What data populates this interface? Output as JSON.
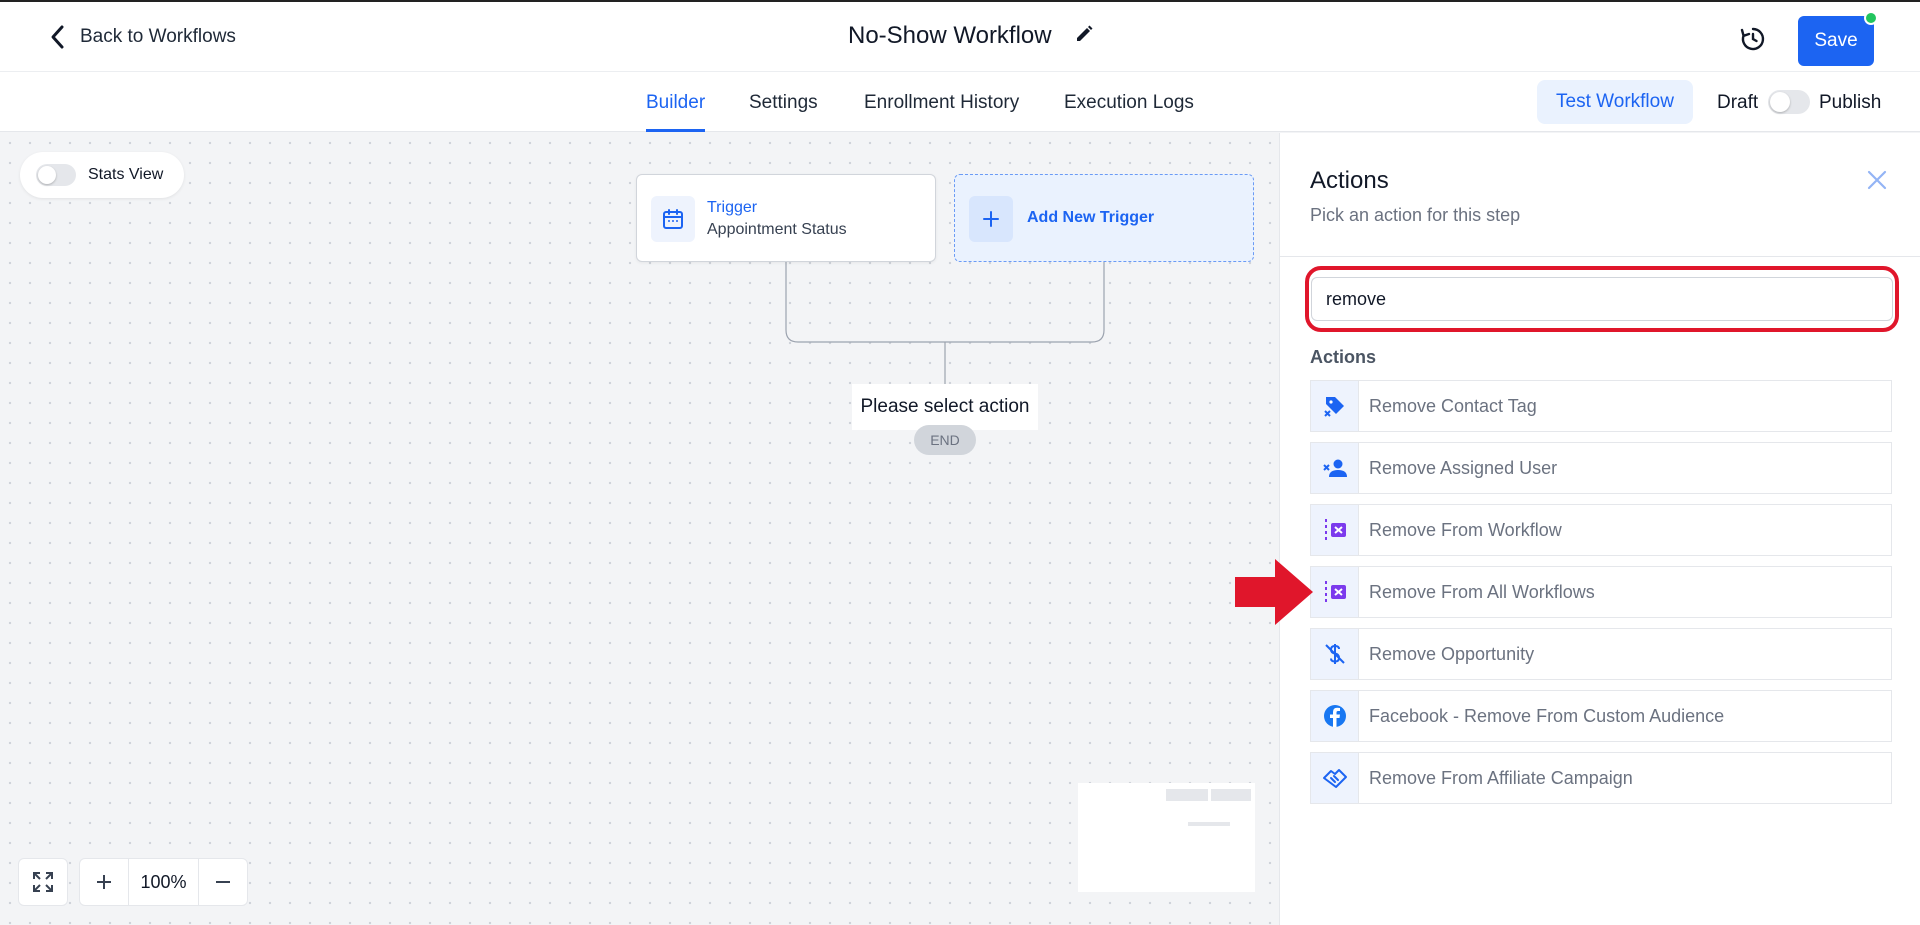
{
  "header": {
    "back_label": "Back to Workflows",
    "workflow_title": "No-Show Workflow",
    "save_label": "Save"
  },
  "tabs": [
    {
      "label": "Builder",
      "active": true
    },
    {
      "label": "Settings",
      "active": false
    },
    {
      "label": "Enrollment History",
      "active": false
    },
    {
      "label": "Execution Logs",
      "active": false
    }
  ],
  "toolbar": {
    "test_label": "Test Workflow",
    "draft_label": "Draft",
    "publish_label": "Publish",
    "published": false
  },
  "canvas": {
    "stats_label": "Stats View",
    "stats_on": false,
    "trigger_title": "Trigger",
    "trigger_sub": "Appointment Status",
    "add_trigger_label": "Add New Trigger",
    "select_action_label": "Please select action",
    "end_label": "END",
    "zoom_value": "100%"
  },
  "panel": {
    "title": "Actions",
    "subtitle": "Pick an action for this step",
    "search_value": "remove",
    "section_label": "Actions",
    "actions": [
      {
        "label": "Remove Contact Tag",
        "icon": "tag-remove-icon"
      },
      {
        "label": "Remove Assigned User",
        "icon": "user-remove-icon"
      },
      {
        "label": "Remove From Workflow",
        "icon": "workflow-remove-icon"
      },
      {
        "label": "Remove From All Workflows",
        "icon": "workflow-remove-all-icon"
      },
      {
        "label": "Remove Opportunity",
        "icon": "dollar-off-icon"
      },
      {
        "label": "Facebook - Remove From Custom Audience",
        "icon": "facebook-icon"
      },
      {
        "label": "Remove From Affiliate Campaign",
        "icon": "handshake-icon"
      }
    ]
  },
  "colors": {
    "primary": "#1c64f2",
    "highlight": "#e0162b",
    "purple_icon": "#7c3aed",
    "status_dot": "#22c55e"
  }
}
